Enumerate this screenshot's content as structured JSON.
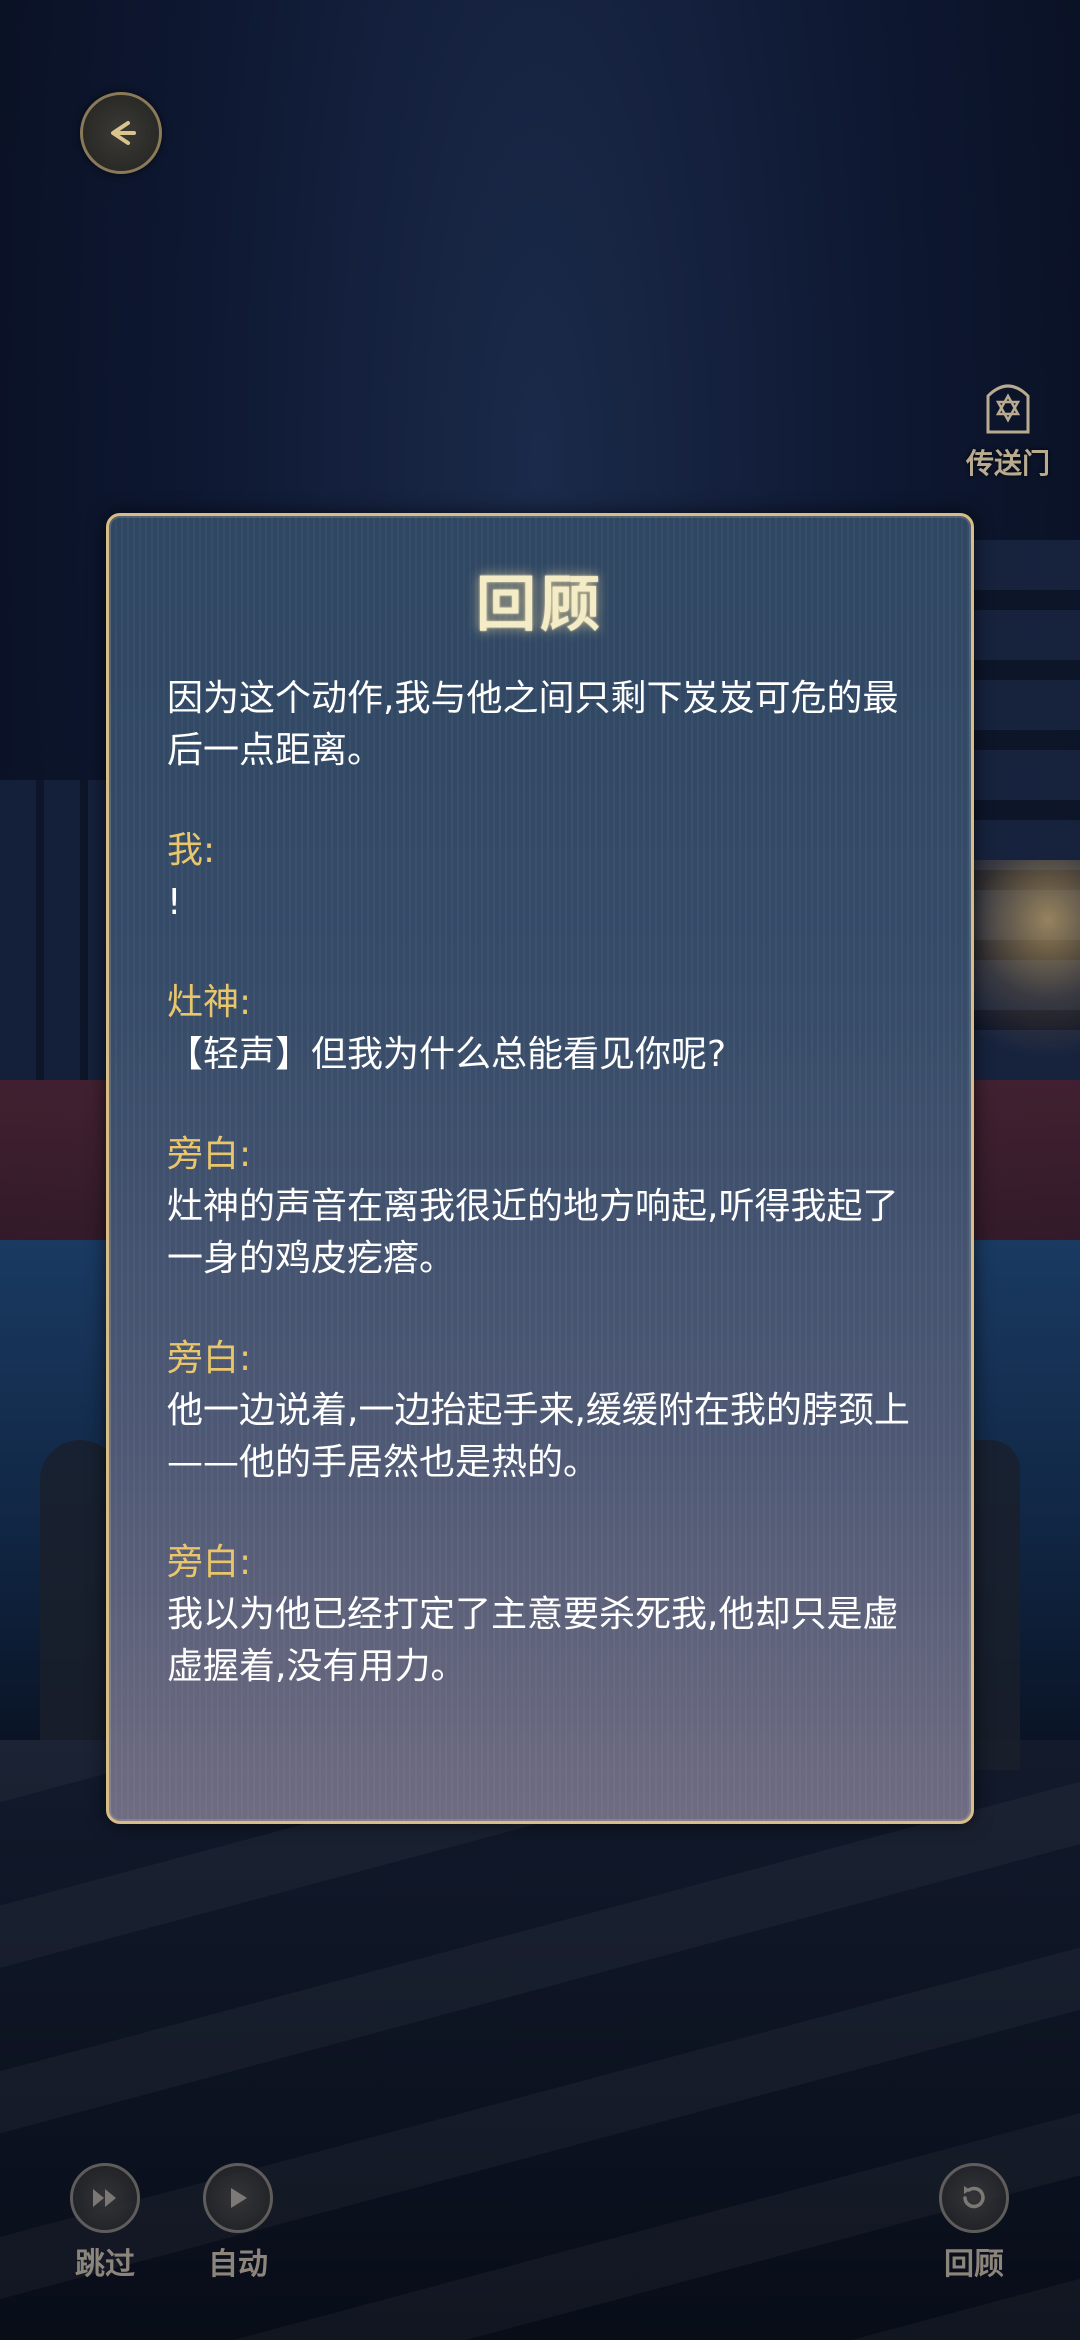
{
  "panel": {
    "title": "回顾",
    "entries": [
      {
        "speaker": "",
        "text": "因为这个动作,我与他之间只剩下岌岌可危的最后一点距离。"
      },
      {
        "speaker": "我:",
        "text": "!"
      },
      {
        "speaker": "灶神:",
        "text": "【轻声】但我为什么总能看见你呢?"
      },
      {
        "speaker": "旁白:",
        "text": "灶神的声音在离我很近的地方响起,听得我起了一身的鸡皮疙瘩。"
      },
      {
        "speaker": "旁白:",
        "text": "他一边说着,一边抬起手来,缓缓附在我的脖颈上——他的手居然也是热的。"
      },
      {
        "speaker": "旁白:",
        "text": "我以为他已经打定了主意要杀死我,他却只是虚虚握着,没有用力。"
      }
    ]
  },
  "top_right": {
    "portal_label": "传送门",
    "icon": "portal-star-icon"
  },
  "top_left": {
    "icon": "back-arrow-icon"
  },
  "controls": {
    "skip_label": "跳过",
    "auto_label": "自动",
    "review_label": "回顾"
  },
  "colors": {
    "speaker": "#e9c66b",
    "border": "#d8bd86",
    "title": "#f4ecc6"
  }
}
